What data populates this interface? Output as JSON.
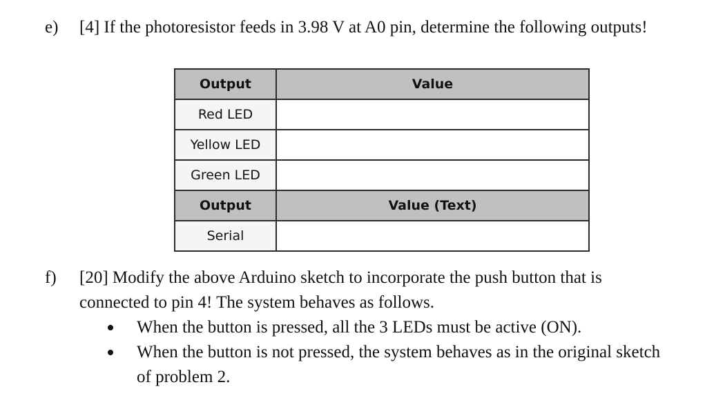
{
  "question_e": {
    "marker": "e)",
    "text": "[4] If the photoresistor feeds in 3.98 V at A0 pin, determine the following outputs!"
  },
  "table": {
    "header1": {
      "output": "Output",
      "value": "Value"
    },
    "rows1": [
      {
        "output": "Red LED",
        "value": ""
      },
      {
        "output": "Yellow LED",
        "value": ""
      },
      {
        "output": "Green LED",
        "value": ""
      }
    ],
    "header2": {
      "output": "Output",
      "value": "Value (Text)"
    },
    "rows2": [
      {
        "output": "Serial",
        "value": ""
      }
    ]
  },
  "question_f": {
    "marker": "f)",
    "text": "[20] Modify the above Arduino sketch to incorporate the push button that is connected to pin 4! The system behaves as follows.",
    "bullets": [
      "When the button is pressed, all the 3 LEDs must be active (ON).",
      "When the button is not pressed, the system behaves as in the original sketch of problem 2."
    ]
  }
}
